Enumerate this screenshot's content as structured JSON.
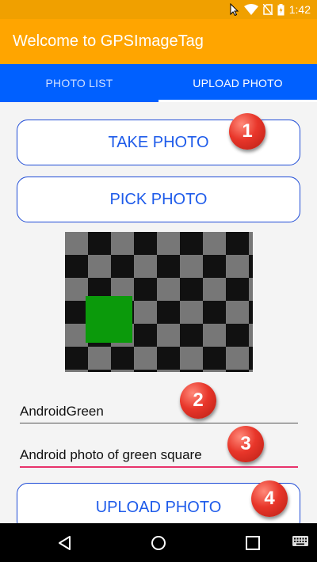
{
  "status_bar": {
    "time": "1:42",
    "icons": [
      "cursor-icon",
      "wifi-icon",
      "no-sim-icon",
      "battery-icon"
    ]
  },
  "app_bar": {
    "title": "Welcome to GPSImageTag"
  },
  "tabs": [
    {
      "label": "PHOTO LIST",
      "active": false
    },
    {
      "label": "UPLOAD PHOTO",
      "active": true
    }
  ],
  "actions": {
    "take_photo": "TAKE PHOTO",
    "pick_photo": "PICK PHOTO",
    "upload_photo": "UPLOAD PHOTO"
  },
  "form": {
    "title_value": "AndroidGreen",
    "description_value": "Android photo of green square"
  },
  "markers": [
    "1",
    "2",
    "3",
    "4"
  ],
  "nav_bar": {
    "icons": [
      "back-icon",
      "home-icon",
      "recents-icon",
      "keyboard-icon"
    ]
  },
  "colors": {
    "status_bar": "#f0a000",
    "app_bar": "#ffa500",
    "tab_bar": "#0060ff",
    "button_text": "#1e5bea",
    "focus_underline": "#e8336b",
    "marker": "#e8362a",
    "photo_square": "#0b9a0b"
  }
}
